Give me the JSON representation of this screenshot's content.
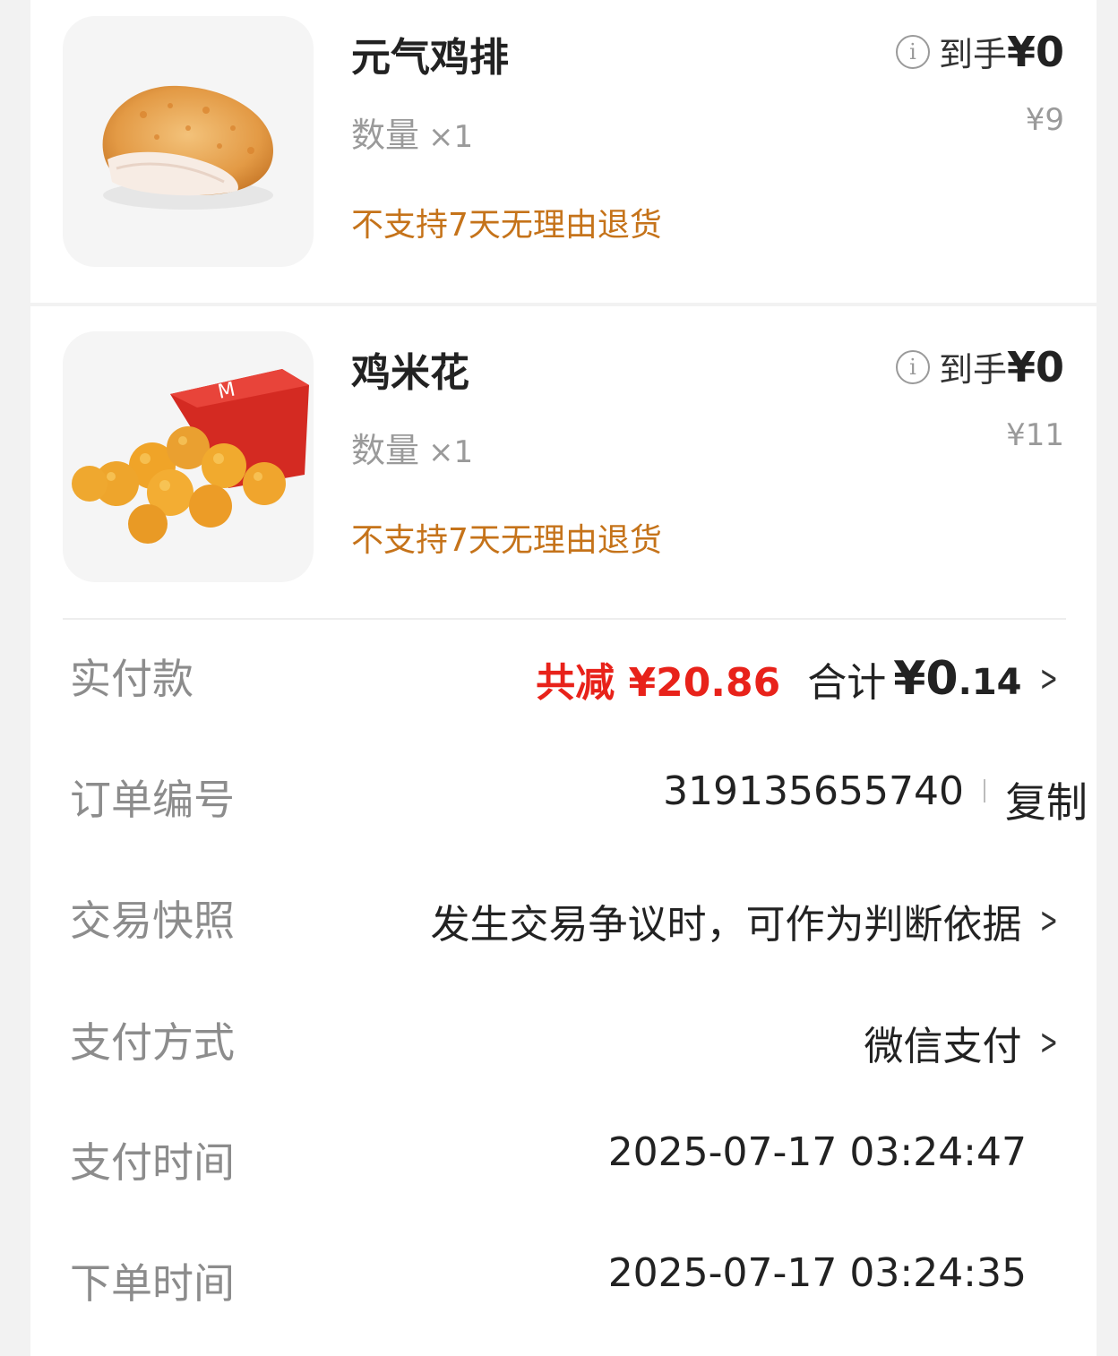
{
  "items": [
    {
      "name": "元气鸡排",
      "quantity_label": "数量",
      "quantity": "×1",
      "policy": "不支持7天无理由退货",
      "net_label": "到手",
      "net_price": "¥0",
      "original_price": "¥9",
      "image_icon": "chicken-cutlet-image"
    },
    {
      "name": "鸡米花",
      "quantity_label": "数量",
      "quantity": "×1",
      "policy": "不支持7天无理由退货",
      "net_label": "到手",
      "net_price": "¥0",
      "original_price": "¥11",
      "image_icon": "popcorn-chicken-image"
    }
  ],
  "summary": {
    "paid": {
      "label": "实付款",
      "discount": "共减 ¥20.86",
      "total_label": "合计",
      "total_currency_int": "¥0",
      "total_decimal": ".14"
    },
    "order_number": {
      "label": "订单编号",
      "value": "319135655740",
      "copy_label": "复制"
    },
    "snapshot": {
      "label": "交易快照",
      "value": "发生交易争议时，可作为判断依据"
    },
    "payment_method": {
      "label": "支付方式",
      "value": "微信支付"
    },
    "payment_time": {
      "label": "支付时间",
      "value": "2025-07-17 03:24:47"
    },
    "order_time": {
      "label": "下单时间",
      "value": "2025-07-17 03:24:35"
    }
  },
  "colors": {
    "discount_red": "#e8221a",
    "policy_orange": "#c5731a"
  }
}
